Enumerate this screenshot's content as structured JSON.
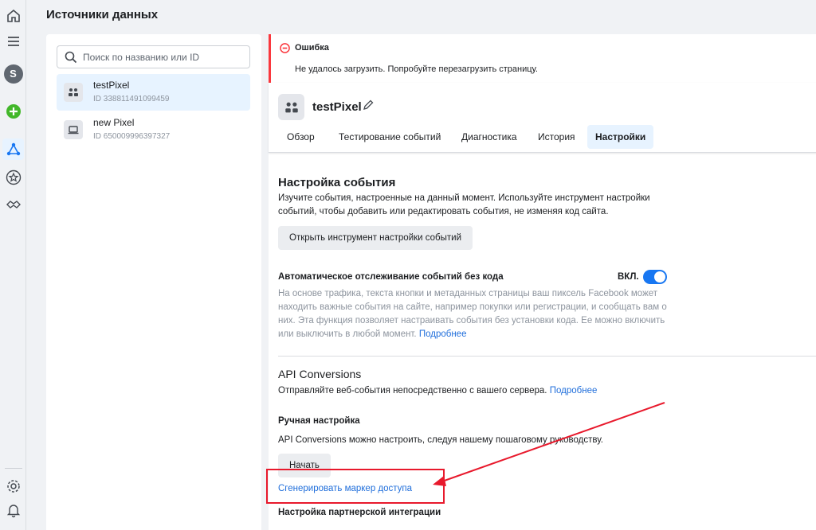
{
  "page": {
    "title": "Источники данных"
  },
  "rail": {
    "avatar_letter": "S",
    "icons": [
      "home-icon",
      "menu-icon",
      "avatar",
      "add-icon",
      "events-manager-icon",
      "star-icon",
      "partner-icon",
      "settings-icon",
      "bell-icon"
    ]
  },
  "sources": {
    "search_placeholder": "Поиск по названию или ID",
    "items": [
      {
        "name": "testPixel",
        "id": "ID 338811491099459",
        "active": true
      },
      {
        "name": "new Pixel",
        "id": "ID 650009996397327",
        "active": false
      }
    ]
  },
  "alert": {
    "title": "Ошибка",
    "text": "Не удалось загрузить. Попробуйте перезагрузить страницу.",
    "color": "#fa383e"
  },
  "pixel": {
    "name": "testPixel",
    "tabs": [
      {
        "label": "Обзор",
        "active": false
      },
      {
        "label": "Тестирование событий",
        "active": false
      },
      {
        "label": "Диагностика",
        "active": false
      },
      {
        "label": "История",
        "active": false
      },
      {
        "label": "Настройки",
        "active": true
      }
    ]
  },
  "event_setup": {
    "title": "Настройка события",
    "description": "Изучите события, настроенные на данный момент. Используйте инструмент настройки событий, чтобы добавить или редактировать события, не изменяя код сайта.",
    "button": "Открыть инструмент настройки событий"
  },
  "auto_tracking": {
    "title": "Автоматическое отслеживание событий без кода",
    "toggle_label": "ВКЛ.",
    "toggle_on": true,
    "description": "На основе трафика, текста кнопки и метаданных страницы ваш пиксель Facebook может находить важные события на сайте, например покупки или регистрации, и сообщать вам о них. Эта функция позволяет настраивать события без установки кода. Ее можно включить или выключить в любой момент.",
    "link": "Подробнее"
  },
  "api": {
    "title": "API Conversions",
    "description": "Отправляйте веб-события непосредственно с вашего сервера.",
    "link": "Подробнее",
    "manual_title": "Ручная настройка",
    "manual_description": "API Conversions можно настроить, следуя нашему пошаговому руководству.",
    "start_button": "Начать",
    "token_link": "Сгенерировать маркер доступа",
    "partner_title": "Настройка партнерской интеграции"
  },
  "colors": {
    "accent": "#1877f2",
    "link": "#216fdb",
    "annotation": "#e8192c"
  }
}
